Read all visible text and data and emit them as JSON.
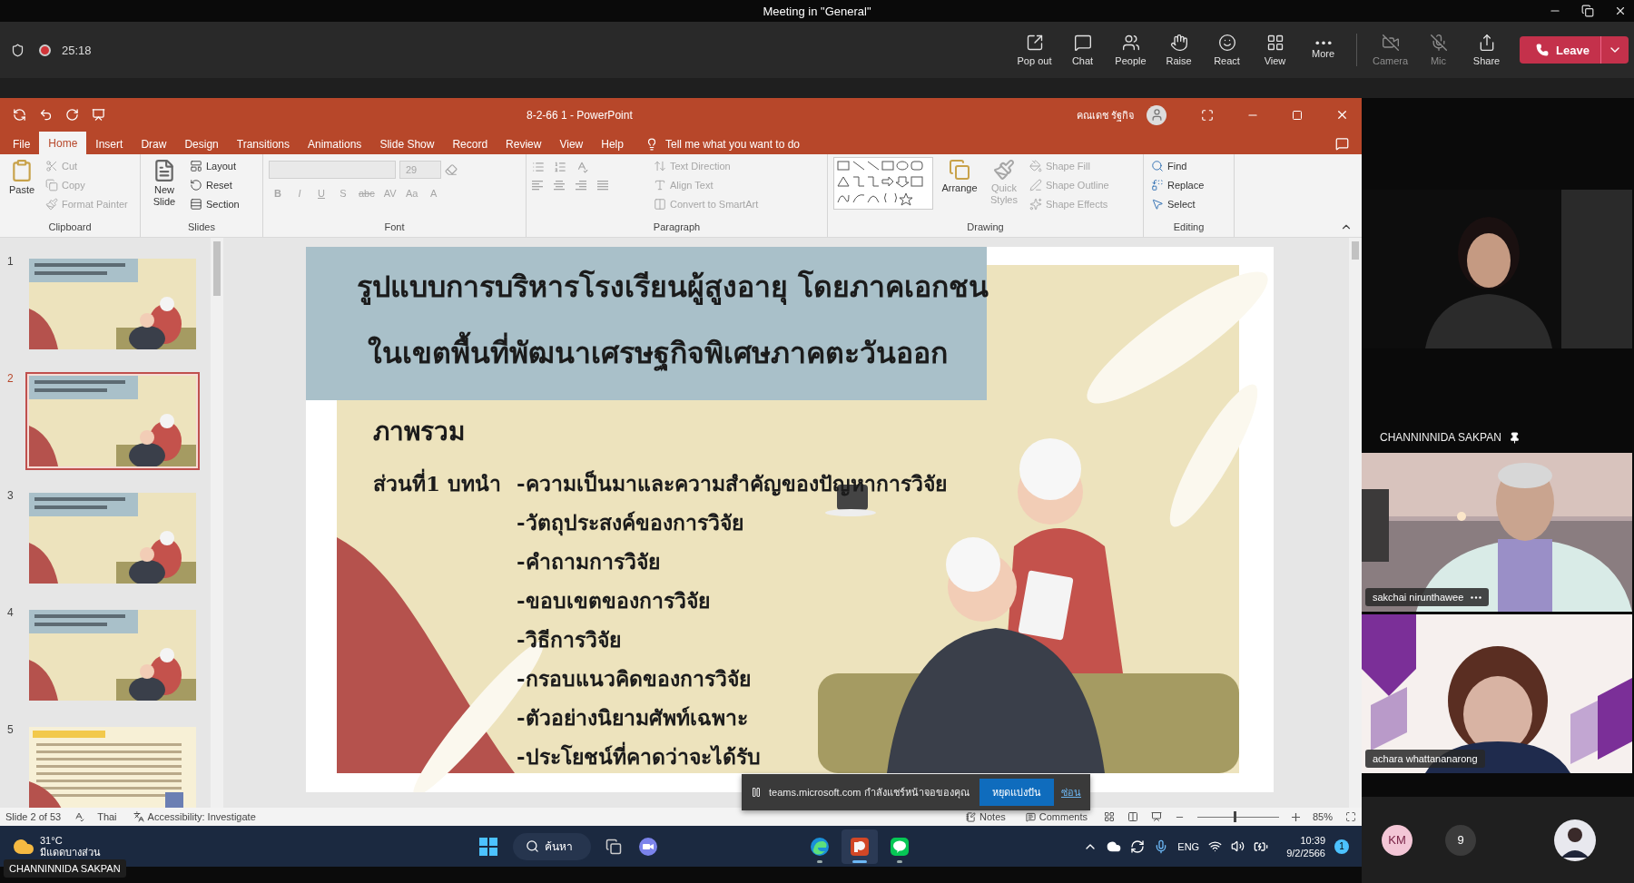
{
  "window": {
    "title": "Meeting in \"General\""
  },
  "meeting": {
    "timer": "25:18",
    "recording": true
  },
  "toolbar": [
    {
      "kind": "popout",
      "label": "Pop out",
      "off": false
    },
    {
      "kind": "chat",
      "label": "Chat",
      "off": false
    },
    {
      "kind": "people",
      "label": "People",
      "off": false
    },
    {
      "kind": "raise",
      "label": "Raise",
      "off": false
    },
    {
      "kind": "react",
      "label": "React",
      "off": false
    },
    {
      "kind": "view",
      "label": "View",
      "off": false
    },
    {
      "kind": "more",
      "label": "More",
      "off": false
    },
    {
      "kind": "camera",
      "label": "Camera",
      "off": true
    },
    {
      "kind": "mic",
      "label": "Mic",
      "off": true
    },
    {
      "kind": "share",
      "label": "Share",
      "off": false
    }
  ],
  "leave": {
    "label": "Leave"
  },
  "powerpoint": {
    "title": "8-2-66 1 - PowerPoint",
    "user": "คณเดช รัฐกิจ",
    "tabs": [
      {
        "label": "File",
        "selected": false
      },
      {
        "label": "Home",
        "selected": true
      },
      {
        "label": "Insert",
        "selected": false
      },
      {
        "label": "Draw",
        "selected": false
      },
      {
        "label": "Design",
        "selected": false
      },
      {
        "label": "Transitions",
        "selected": false
      },
      {
        "label": "Animations",
        "selected": false
      },
      {
        "label": "Slide Show",
        "selected": false
      },
      {
        "label": "Record",
        "selected": false
      },
      {
        "label": "Review",
        "selected": false
      },
      {
        "label": "View",
        "selected": false
      },
      {
        "label": "Help",
        "selected": false
      }
    ],
    "tell_me": "Tell me what you want to do",
    "clipboard": {
      "label": "Clipboard",
      "paste": "Paste",
      "items": [
        {
          "kind": "cut",
          "label": "Cut",
          "disabled": true
        },
        {
          "kind": "copy",
          "label": "Copy",
          "disabled": true
        },
        {
          "kind": "painter",
          "label": "Format Painter",
          "disabled": true
        }
      ]
    },
    "slides_group": {
      "label": "Slides",
      "new_slide": "New Slide",
      "items": [
        {
          "kind": "layout",
          "label": "Layout"
        },
        {
          "kind": "reset",
          "label": "Reset"
        },
        {
          "kind": "section",
          "label": "Section"
        }
      ]
    },
    "font": {
      "label": "Font",
      "size": "29",
      "disabled": true,
      "buttons": [
        "B",
        "I",
        "U",
        "S",
        "abc",
        "AV",
        "Aa",
        "A"
      ]
    },
    "paragraph": {
      "label": "Paragraph",
      "items": [
        {
          "kind": "direction",
          "label": "Text Direction",
          "disabled": true
        },
        {
          "kind": "align",
          "label": "Align Text",
          "disabled": true
        },
        {
          "kind": "smartart",
          "label": "Convert to SmartArt",
          "disabled": true
        }
      ]
    },
    "drawing": {
      "label": "Drawing",
      "arrange": "Arrange",
      "quick_styles": {
        "label": "Quick Styles",
        "disabled": true
      },
      "items": [
        {
          "kind": "fill",
          "label": "Shape Fill",
          "disabled": true
        },
        {
          "kind": "outline",
          "label": "Shape Outline",
          "disabled": true
        },
        {
          "kind": "effects",
          "label": "Shape Effects",
          "disabled": true
        }
      ]
    },
    "editing": {
      "label": "Editing",
      "items": [
        {
          "kind": "find",
          "label": "Find"
        },
        {
          "kind": "replace",
          "label": "Replace"
        },
        {
          "kind": "select",
          "label": "Select"
        }
      ]
    },
    "thumbnails": [
      {
        "number": "1",
        "kind": "illustrated",
        "selected": false
      },
      {
        "number": "2",
        "kind": "illustrated",
        "selected": true
      },
      {
        "number": "3",
        "kind": "illustrated",
        "selected": false
      },
      {
        "number": "4",
        "kind": "illustrated",
        "selected": false
      },
      {
        "number": "5",
        "kind": "text",
        "selected": false
      }
    ],
    "slide": {
      "title_lines": [
        "รูปแบบการบริหารโรงเรียนผู้สูงอายุ โดยภาคเอกชน",
        "ในเขตพื้นที่พัฒนาเศรษฐกิจพิเศษภาคตะวันออก"
      ],
      "heading": "ภาพรวม",
      "section": "ส่วนที่1 บทนำ",
      "items": [
        "-ความเป็นมาและความสำคัญของปัญหาการวิจัย",
        "-วัตถุประสงค์ของการวิจัย",
        "-คำถามการวิจัย",
        "-ขอบเขตของการวิจัย",
        "-วิธีการวิจัย",
        "-กรอบแนวคิดของการวิจัย",
        "-ตัวอย่างนิยามศัพท์เฉพาะ",
        "-ประโยชน์ที่คาดว่าจะได้รับ"
      ]
    },
    "status": {
      "slide": "Slide 2 of 53",
      "language": "Thai",
      "accessibility": "Accessibility: Investigate",
      "notes": "Notes",
      "comments": "Comments",
      "zoom": "85%",
      "zoom_slider": {
        "level": 0.45
      }
    }
  },
  "share_notice": {
    "text": "teams.microsoft.com กำลังแชร์หน้าจอของคุณ",
    "stop": "หยุดแบ่งปัน",
    "hide": "ซ่อน"
  },
  "taskbar": {
    "temperature": "31°C",
    "weather": "มีแดดบางส่วน",
    "search": "ค้นหา",
    "apps": [
      {
        "kind": "edge",
        "active": false
      },
      {
        "kind": "powerpoint",
        "active": true
      },
      {
        "kind": "line",
        "active": false
      }
    ],
    "language": "ENG",
    "time": "10:39",
    "date": "9/2/2566",
    "badge": "1"
  },
  "presenter": "CHANNINNIDA SAKPAN",
  "participants": [
    {
      "kind": "spotlight",
      "name": "CHANNINNIDA SAKPAN",
      "pinned": true
    },
    {
      "kind": "tile",
      "name": "sakchai nirunthawee",
      "pinned": false
    },
    {
      "kind": "tile",
      "name": "achara whattananarong",
      "pinned": false
    }
  ],
  "roster": {
    "initials": "KM",
    "count": "9"
  }
}
